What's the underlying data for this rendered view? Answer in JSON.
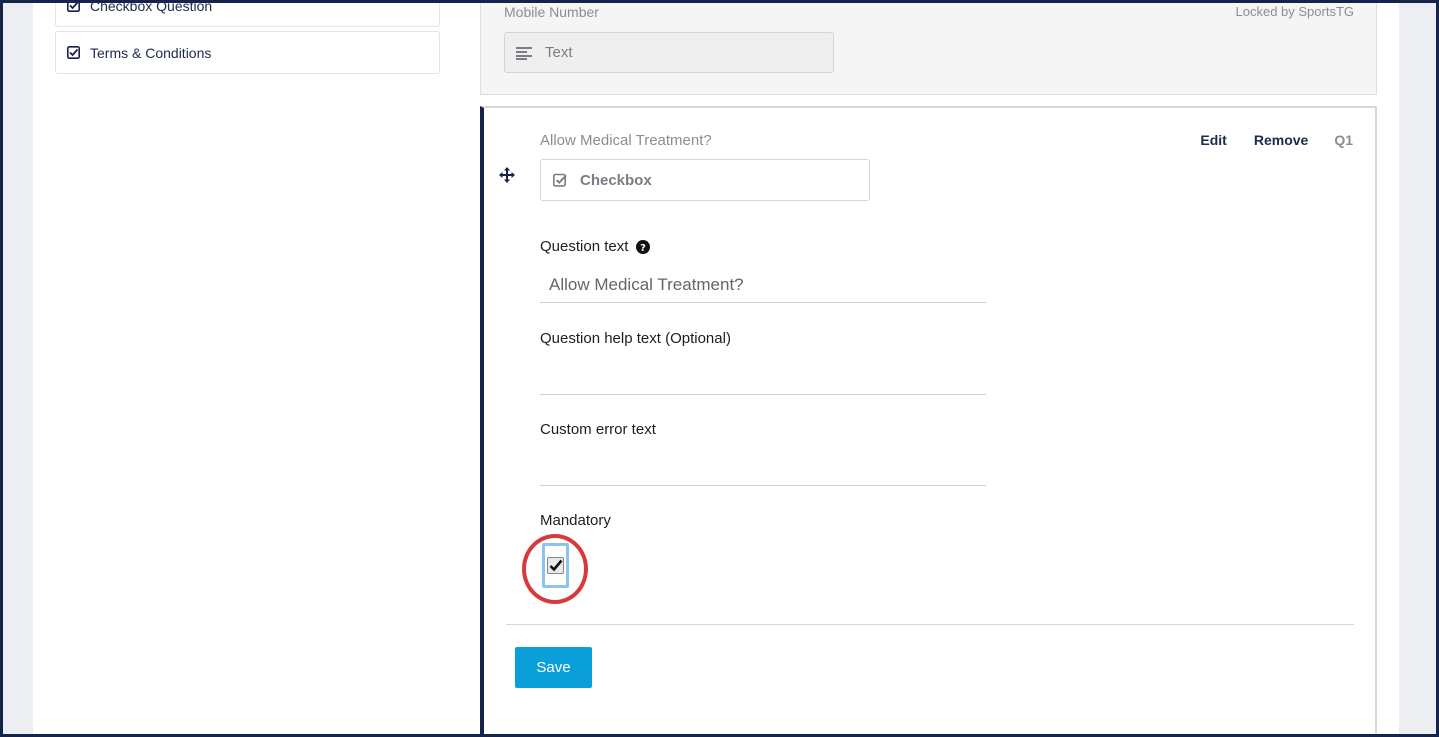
{
  "sidebar": {
    "items": [
      {
        "label": "Checkbox Question",
        "icon": "checkbox-icon"
      },
      {
        "label": "Terms & Conditions",
        "icon": "checkbox-icon"
      }
    ]
  },
  "mobile_question": {
    "label": "Mobile Number",
    "locked_text": "Locked by SportsTG",
    "type_label": "Text",
    "type_icon": "text-lines-icon"
  },
  "active_question": {
    "title": "Allow Medical Treatment?",
    "edit_label": "Edit",
    "remove_label": "Remove",
    "number": "Q1",
    "type_label": "Checkbox",
    "type_icon": "checkbox-icon",
    "fields": {
      "question_text_label": "Question text",
      "question_text_value": "Allow Medical Treatment?",
      "help_text_label": "Question help text (Optional)",
      "help_text_value": "",
      "error_text_label": "Custom error text",
      "error_text_value": "",
      "mandatory_label": "Mandatory",
      "mandatory_checked": true
    },
    "save_label": "Save"
  },
  "colors": {
    "accent": "#0a9fd8",
    "navy": "#16234a",
    "highlight": "#d83a3a",
    "focus_outline": "#8cc4ef"
  }
}
